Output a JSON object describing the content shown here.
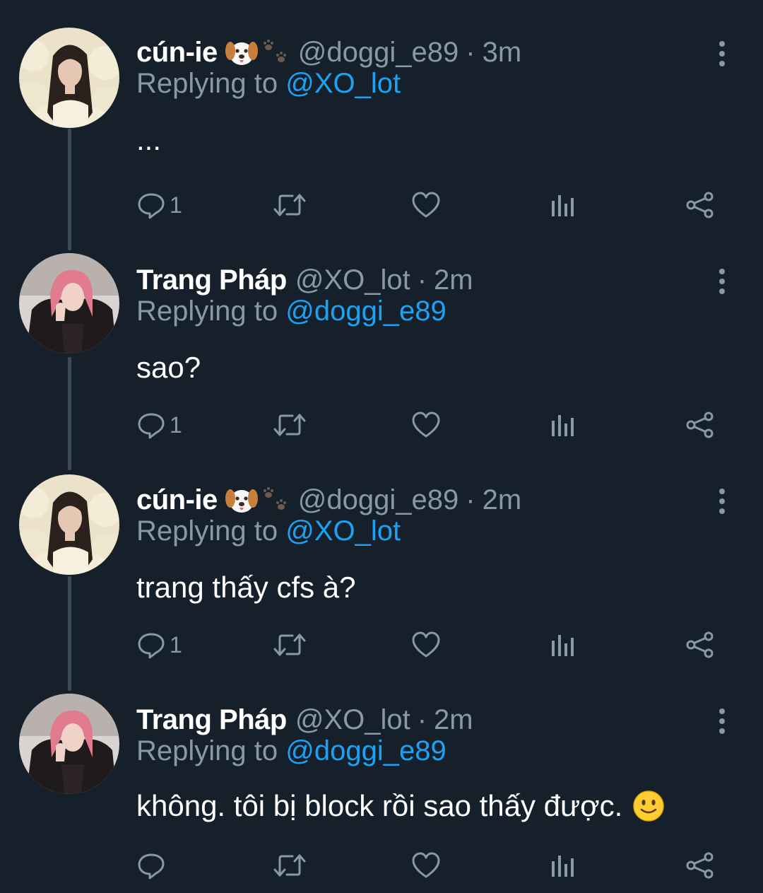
{
  "tweets": [
    {
      "author": "cún-ie",
      "handle": "@doggi_e89",
      "separator": "·",
      "time": "3m",
      "replying_prefix": "Replying to",
      "replying_to": "@XO_lot",
      "text": "...",
      "reply_count": "1",
      "name_emoji": [
        "dog-face",
        "paw-prints"
      ],
      "avatar": "woman-dark-hair-cream-knit"
    },
    {
      "author": "Trang Pháp",
      "handle": "@XO_lot",
      "separator": "·",
      "time": "2m",
      "replying_prefix": "Replying to",
      "replying_to": "@doggi_e89",
      "text": "sao?",
      "reply_count": "1",
      "avatar": "woman-pink-hair-black-outfit"
    },
    {
      "author": "cún-ie",
      "handle": "@doggi_e89",
      "separator": "·",
      "time": "2m",
      "replying_prefix": "Replying to",
      "replying_to": "@XO_lot",
      "text": "trang thấy cfs à?",
      "reply_count": "1",
      "name_emoji": [
        "dog-face",
        "paw-prints"
      ],
      "avatar": "woman-dark-hair-cream-knit"
    },
    {
      "author": "Trang Pháp",
      "handle": "@XO_lot",
      "separator": "·",
      "time": "2m",
      "replying_prefix": "Replying to",
      "replying_to": "@doggi_e89",
      "text": "không. tôi bị block rồi sao thấy được.",
      "text_emoji": "slightly-smiling-face",
      "reply_count": "",
      "avatar": "woman-pink-hair-black-outfit"
    }
  ],
  "icons": [
    "reply-icon",
    "retweet-icon",
    "like-icon",
    "analytics-icon",
    "share-icon",
    "more-icon"
  ],
  "colors": {
    "background": "#15202b",
    "secondary_text": "#8899a6",
    "mention": "#1da1f2",
    "thread_line": "#3d4b59"
  }
}
